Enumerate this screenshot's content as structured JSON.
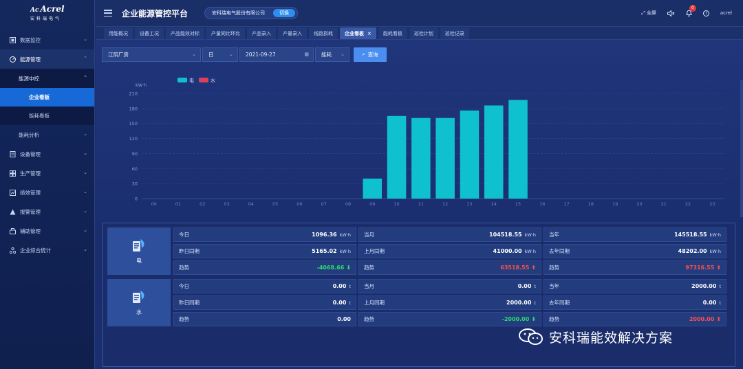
{
  "brand": {
    "name": "Acrel",
    "mark": "Ac",
    "sub": "安科瑞电气"
  },
  "app_title": "企业能源管控平台",
  "company": {
    "name": "安科瑞电气股份有限公司",
    "switch_label": "切换"
  },
  "topbar": {
    "fullscreen": "全屏",
    "notification_count": "0",
    "user": "acrel"
  },
  "sidebar": {
    "items": [
      {
        "label": "数据监控",
        "icon": "monitor-icon"
      },
      {
        "label": "能源管理",
        "icon": "energy-icon"
      },
      {
        "label": "设备管理",
        "icon": "device-icon"
      },
      {
        "label": "生产管理",
        "icon": "production-icon"
      },
      {
        "label": "绩效管理",
        "icon": "performance-icon"
      },
      {
        "label": "报警管理",
        "icon": "alarm-icon"
      },
      {
        "label": "辅助管理",
        "icon": "assist-icon"
      },
      {
        "label": "企业综合统计",
        "icon": "statistics-icon"
      }
    ],
    "energy_sub": {
      "group": "能源中控",
      "items": [
        "企业看板",
        "能耗看板"
      ],
      "active": "企业看板",
      "group2": "能耗分析"
    }
  },
  "tabs": [
    "用能概况",
    "设备工况",
    "产品能效对标",
    "产量同比环比",
    "产品录入",
    "产量录入",
    "线路损耗",
    "企业看板",
    "能耗看板",
    "巡检计划",
    "巡检记录"
  ],
  "active_tab": "企业看板",
  "filters": {
    "site": "江阴厂房",
    "period": "日",
    "date": "2021-09-27",
    "metric": "能耗",
    "query_label": "查询"
  },
  "chart_data": {
    "type": "bar",
    "unit": "kW·h",
    "ylim": [
      0,
      210
    ],
    "yticks": [
      0,
      30,
      60,
      90,
      120,
      150,
      180,
      210
    ],
    "categories": [
      "00",
      "01",
      "02",
      "03",
      "04",
      "05",
      "06",
      "07",
      "08",
      "09",
      "10",
      "11",
      "12",
      "13",
      "14",
      "15",
      "16",
      "17",
      "18",
      "19",
      "20",
      "21",
      "22",
      "23"
    ],
    "series": [
      {
        "name": "电",
        "color": "#0fc1cf",
        "values": [
          0,
          0,
          0,
          0,
          0,
          0,
          0,
          0,
          0,
          40,
          165,
          161,
          161,
          176,
          186,
          197,
          0,
          0,
          0,
          0,
          0,
          0,
          0,
          0
        ]
      },
      {
        "name": "水",
        "color": "#d9415f",
        "values": [
          0,
          0,
          0,
          0,
          0,
          0,
          0,
          0,
          0,
          0,
          0,
          0,
          0,
          0,
          0,
          0,
          0,
          0,
          0,
          0,
          0,
          0,
          0,
          0
        ]
      }
    ],
    "legend": "top-left",
    "grid": true
  },
  "summary": {
    "electric": {
      "label": "电",
      "today_k": "今日",
      "today_v": "1096.36",
      "today_u": "kW·h",
      "yest_k": "昨日同期",
      "yest_v": "5165.02",
      "yest_u": "kW·h",
      "trend1_k": "趋势",
      "trend1_v": "-4068.66",
      "trend1_dir": "down",
      "month_k": "当月",
      "month_v": "104518.55",
      "month_u": "kW·h",
      "lastmonth_k": "上月同期",
      "lastmonth_v": "41000.00",
      "lastmonth_u": "kW·h",
      "trend2_k": "趋势",
      "trend2_v": "63518.55",
      "trend2_dir": "up",
      "year_k": "当年",
      "year_v": "145518.55",
      "year_u": "kW·h",
      "lastyear_k": "去年同期",
      "lastyear_v": "48202.00",
      "lastyear_u": "kW·h",
      "trend3_k": "趋势",
      "trend3_v": "97316.55",
      "trend3_dir": "up"
    },
    "water": {
      "label": "水",
      "today_k": "今日",
      "today_v": "0.00",
      "today_u": "t",
      "yest_k": "昨日同期",
      "yest_v": "0.00",
      "yest_u": "t",
      "trend1_k": "趋势",
      "trend1_v": "0.00",
      "month_k": "当月",
      "month_v": "0.00",
      "month_u": "t",
      "lastmonth_k": "上月同期",
      "lastmonth_v": "2000.00",
      "lastmonth_u": "t",
      "trend2_k": "趋势",
      "trend2_v": "-2000.00",
      "trend2_dir": "down",
      "year_k": "当年",
      "year_v": "2000.00",
      "year_u": "t",
      "lastyear_k": "去年同期",
      "lastyear_v": "0.00",
      "lastyear_u": "t",
      "trend3_k": "趋势",
      "trend3_v": "2000.00",
      "trend3_dir": "up"
    }
  },
  "watermark": "安科瑞能效解决方案",
  "colors": {
    "accent": "#1769d8",
    "bar": "#0fc1cf",
    "up": "#ff4d4f",
    "down": "#2bdc6b"
  }
}
